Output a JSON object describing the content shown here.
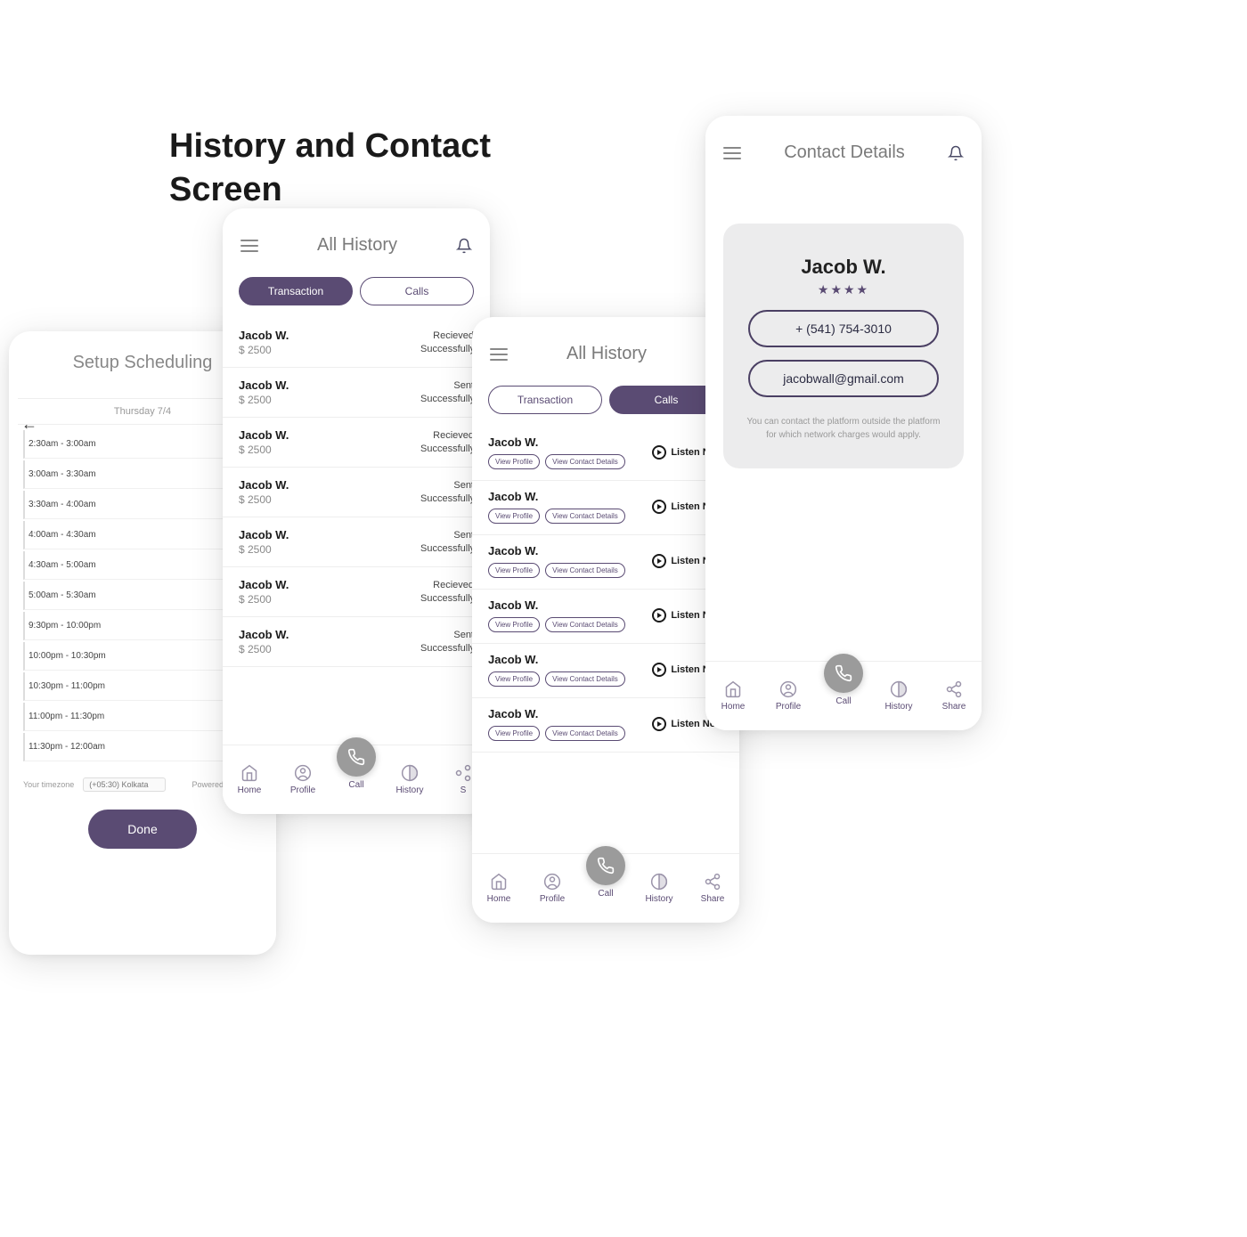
{
  "heading_line1": "History and Contact",
  "heading_line2": "Screen",
  "scheduling": {
    "title": "Setup  Scheduling",
    "date_header": "Thursday 7/4",
    "slots": [
      "2:30am - 3:00am",
      "3:00am - 3:30am",
      "3:30am - 4:00am",
      "4:00am - 4:30am",
      "4:30am - 5:00am",
      "5:00am - 5:30am",
      "9:30pm - 10:00pm",
      "10:00pm - 10:30pm",
      "10:30pm - 11:00pm",
      "11:00pm - 11:30pm",
      "11:30pm - 12:00am"
    ],
    "tz_label": "Your timezone",
    "tz_value": "(+05:30) Kolkata",
    "powered": "Powered by Timekit",
    "done": "Done"
  },
  "history_txn": {
    "title": "All History",
    "tabs": {
      "transaction": "Transaction",
      "calls": "Calls"
    },
    "rows": [
      {
        "name": "Jacob W.",
        "amount": "$ 2500",
        "status1": "Recieved",
        "status2": "Successfully"
      },
      {
        "name": "Jacob W.",
        "amount": "$ 2500",
        "status1": "Sent",
        "status2": "Successfully"
      },
      {
        "name": "Jacob W.",
        "amount": "$ 2500",
        "status1": "Recieved",
        "status2": "Successfully"
      },
      {
        "name": "Jacob W.",
        "amount": "$ 2500",
        "status1": "Sent",
        "status2": "Successfully"
      },
      {
        "name": "Jacob W.",
        "amount": "$ 2500",
        "status1": "Sent",
        "status2": "Successfully"
      },
      {
        "name": "Jacob W.",
        "amount": "$ 2500",
        "status1": "Recieved",
        "status2": "Successfully"
      },
      {
        "name": "Jacob W.",
        "amount": "$ 2500",
        "status1": "Sent",
        "status2": "Successfully"
      }
    ]
  },
  "history_calls": {
    "title": "All History",
    "tabs": {
      "transaction": "Transaction",
      "calls": "Calls"
    },
    "view_profile": "View Profile",
    "view_contact": "View Contact Details",
    "listen": "Listen Now",
    "rows": [
      {
        "name": "Jacob W."
      },
      {
        "name": "Jacob W."
      },
      {
        "name": "Jacob W."
      },
      {
        "name": "Jacob W."
      },
      {
        "name": "Jacob W."
      },
      {
        "name": "Jacob W."
      }
    ]
  },
  "contact": {
    "title": "Contact Details",
    "name": "Jacob W.",
    "stars": "★★★★",
    "phone": "+ (541) 754-3010",
    "email": "jacobwall@gmail.com",
    "note": "You can contact the platform outside the platform for which network charges would apply."
  },
  "nav": {
    "home": "Home",
    "profile": "Profile",
    "call": "Call",
    "history": "History",
    "share": "Share",
    "s_trunc": "S"
  }
}
